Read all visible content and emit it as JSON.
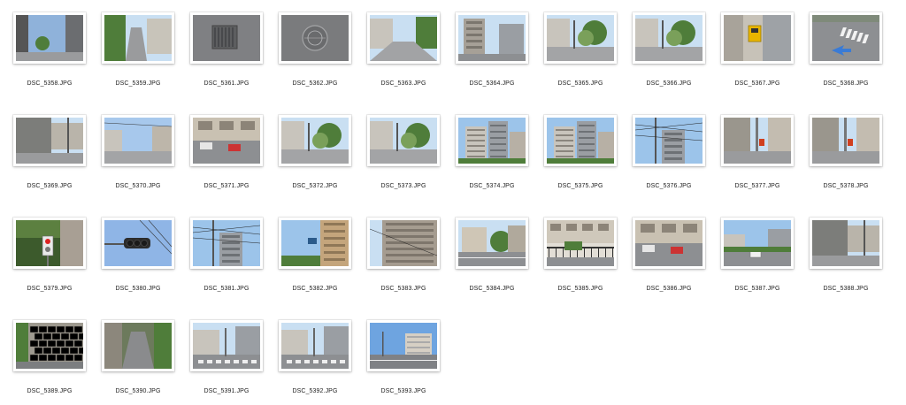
{
  "files": [
    {
      "name": "DSC_5358.JPG",
      "scene": "street-building"
    },
    {
      "name": "DSC_5359.JPG",
      "scene": "alley"
    },
    {
      "name": "DSC_5361.JPG",
      "scene": "drain-grate"
    },
    {
      "name": "DSC_5362.JPG",
      "scene": "manhole"
    },
    {
      "name": "DSC_5363.JPG",
      "scene": "street"
    },
    {
      "name": "DSC_5364.JPG",
      "scene": "buildings"
    },
    {
      "name": "DSC_5365.JPG",
      "scene": "street-trees"
    },
    {
      "name": "DSC_5366.JPG",
      "scene": "street-trees"
    },
    {
      "name": "DSC_5367.JPG",
      "scene": "crosswalk-button"
    },
    {
      "name": "DSC_5368.JPG",
      "scene": "road-markings"
    },
    {
      "name": "DSC_5369.JPG",
      "scene": "wall-corner"
    },
    {
      "name": "DSC_5370.JPG",
      "scene": "street-sky"
    },
    {
      "name": "DSC_5371.JPG",
      "scene": "parking-lot"
    },
    {
      "name": "DSC_5372.JPG",
      "scene": "street-trees"
    },
    {
      "name": "DSC_5373.JPG",
      "scene": "street-trees"
    },
    {
      "name": "DSC_5374.JPG",
      "scene": "apartment-blocks"
    },
    {
      "name": "DSC_5375.JPG",
      "scene": "apartment-blocks"
    },
    {
      "name": "DSC_5376.JPG",
      "scene": "power-lines"
    },
    {
      "name": "DSC_5377.JPG",
      "scene": "street-pole"
    },
    {
      "name": "DSC_5378.JPG",
      "scene": "street-pole"
    },
    {
      "name": "DSC_5379.JPG",
      "scene": "pedestrian-signal"
    },
    {
      "name": "DSC_5380.JPG",
      "scene": "traffic-light"
    },
    {
      "name": "DSC_5381.JPG",
      "scene": "power-lines"
    },
    {
      "name": "DSC_5382.JPG",
      "scene": "traffic-light-building"
    },
    {
      "name": "DSC_5383.JPG",
      "scene": "building-facade"
    },
    {
      "name": "DSC_5384.JPG",
      "scene": "street-house"
    },
    {
      "name": "DSC_5385.JPG",
      "scene": "fence-building"
    },
    {
      "name": "DSC_5386.JPG",
      "scene": "parking-lot"
    },
    {
      "name": "DSC_5387.JPG",
      "scene": "street-cars"
    },
    {
      "name": "DSC_5388.JPG",
      "scene": "wall-street"
    },
    {
      "name": "DSC_5389.JPG",
      "scene": "stone-wall"
    },
    {
      "name": "DSC_5390.JPG",
      "scene": "slope-road"
    },
    {
      "name": "DSC_5391.JPG",
      "scene": "crosswalk"
    },
    {
      "name": "DSC_5392.JPG",
      "scene": "crosswalk"
    },
    {
      "name": "DSC_5393.JPG",
      "scene": "wide-street"
    }
  ],
  "colors": {
    "background": "#ffffff",
    "label_text": "#222222",
    "thumb_border": "#ffffff"
  }
}
